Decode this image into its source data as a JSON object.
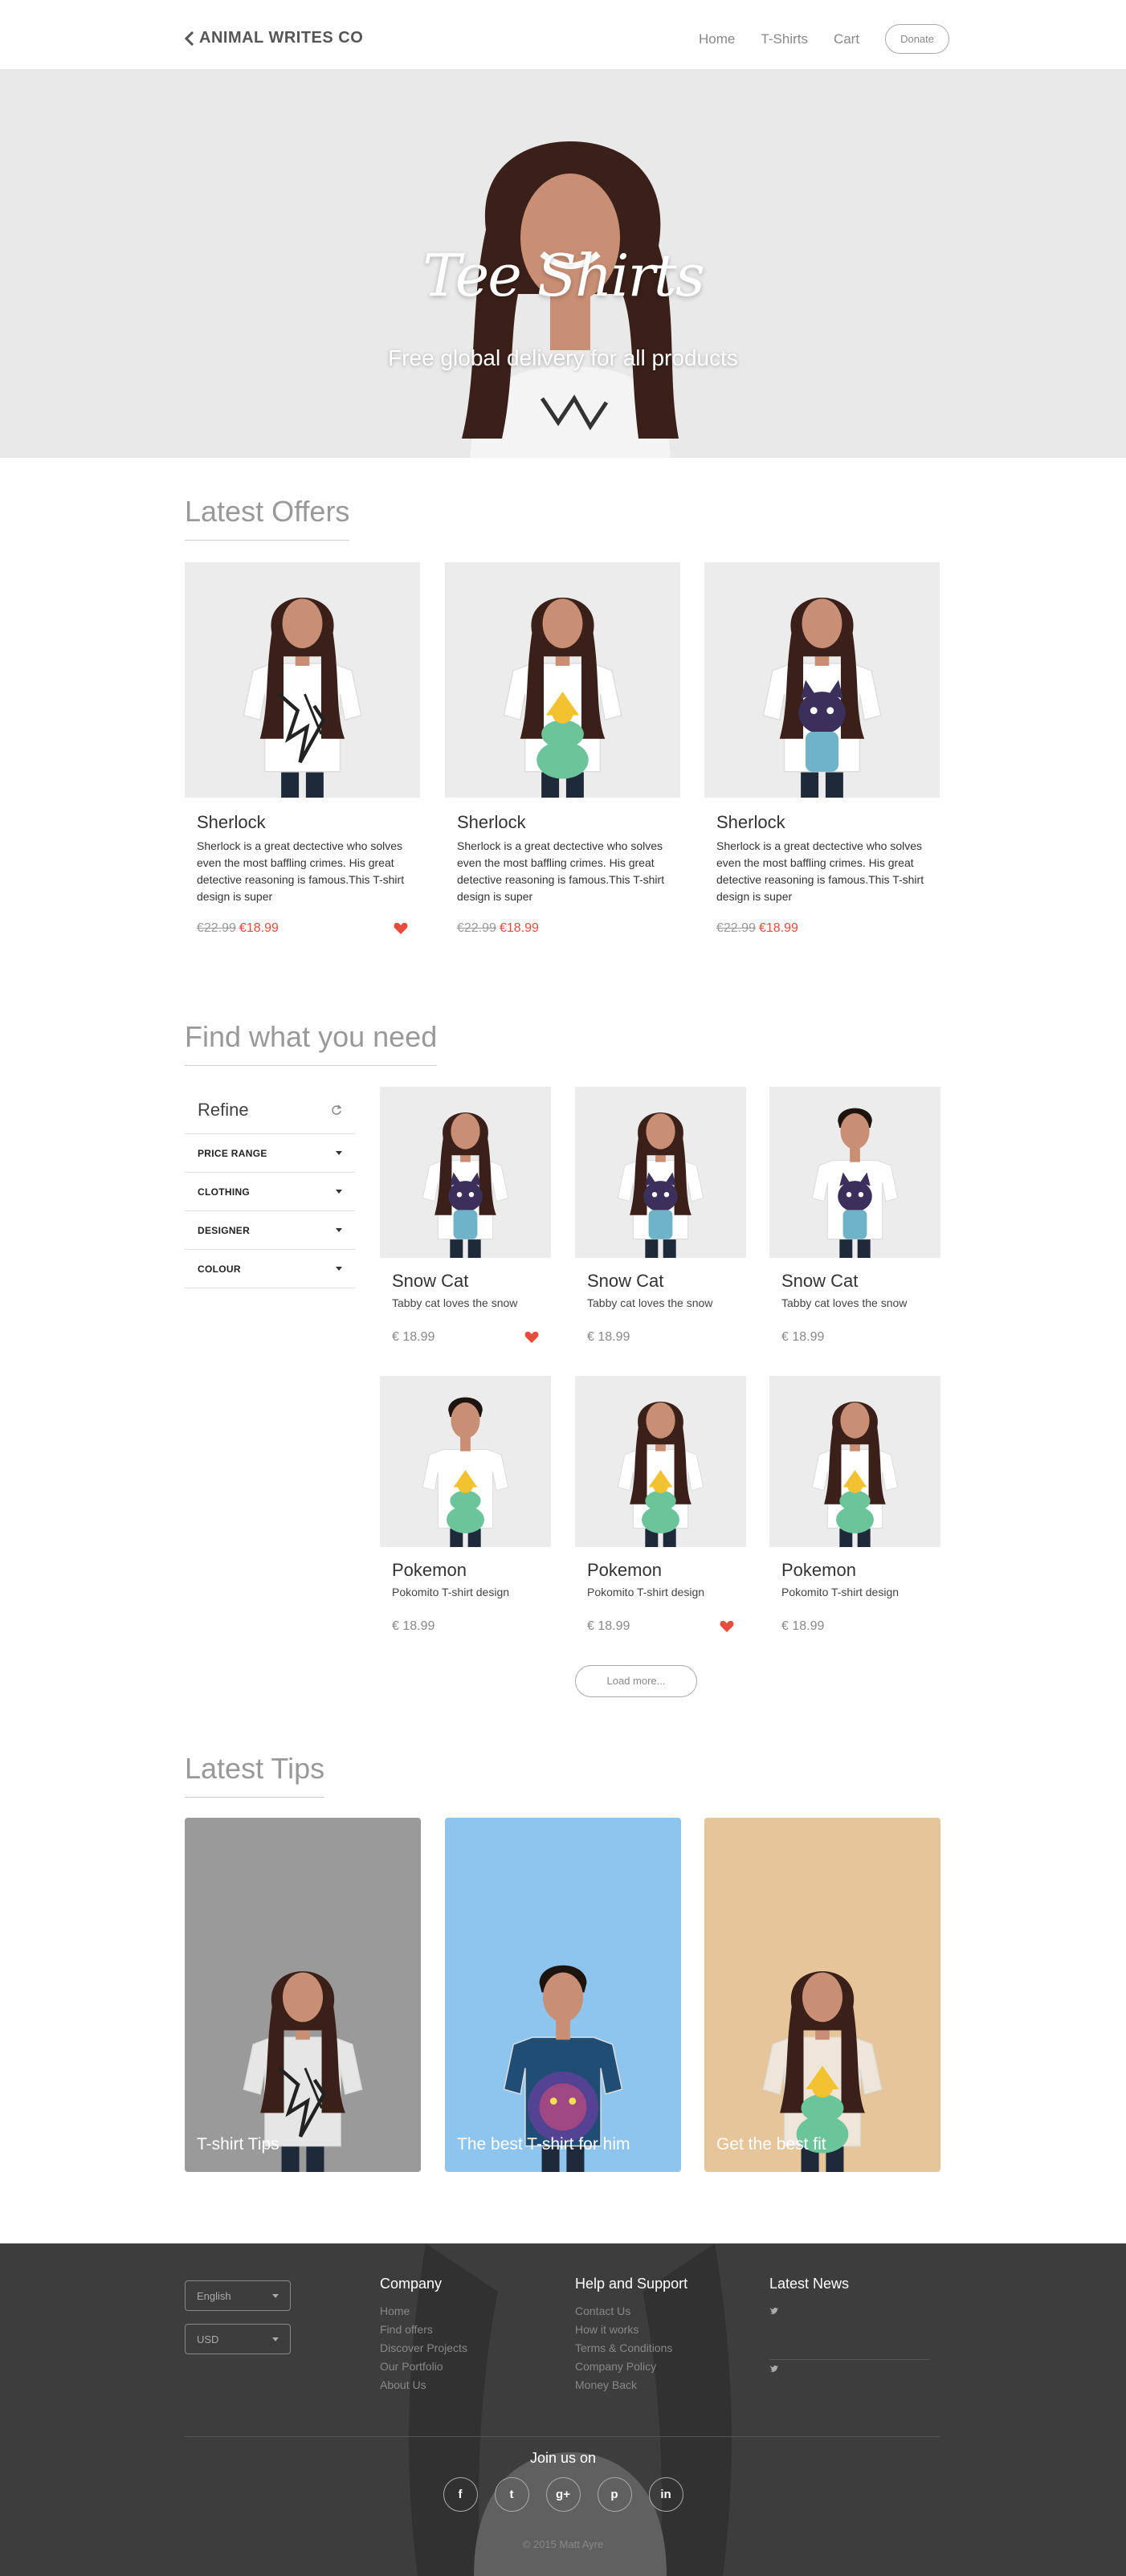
{
  "nav": {
    "brand": "ANIMAL WRITES CO",
    "links": [
      "Home",
      "T-Shirts",
      "Cart"
    ],
    "donate": "Donate"
  },
  "hero": {
    "title": "Tee Shirts",
    "subtitle": "Free global delivery for all products"
  },
  "offers": {
    "title": "Latest Offers",
    "items": [
      {
        "name": "Sherlock",
        "desc": "Sherlock is a great dectective who solves even the most baffling crimes. His great detective reasoning is famous.This T-shirt design is super",
        "old_price": "€22.99",
        "price": "€18.99",
        "liked": true,
        "print": "sketch",
        "shirt": "#ffffff"
      },
      {
        "name": "Sherlock",
        "desc": "Sherlock is a great dectective who solves even the most baffling crimes. His great detective reasoning is famous.This T-shirt design is super",
        "old_price": "€22.99",
        "price": "€18.99",
        "liked": false,
        "print": "pokemon",
        "shirt": "#ffffff"
      },
      {
        "name": "Sherlock",
        "desc": "Sherlock is a great dectective who solves even the most baffling crimes. His great detective reasoning is famous.This T-shirt design is super",
        "old_price": "€22.99",
        "price": "€18.99",
        "liked": false,
        "print": "cat",
        "shirt": "#ffffff"
      }
    ]
  },
  "find": {
    "title": "Find what you need",
    "refine": {
      "heading": "Refine",
      "filters": [
        "PRICE RANGE",
        "CLOTHING",
        "DESIGNER",
        "COLOUR"
      ]
    },
    "products": [
      {
        "name": "Snow Cat",
        "desc": "Tabby cat loves the snow",
        "price": "€ 18.99",
        "liked": true,
        "print": "cat",
        "person": "woman"
      },
      {
        "name": "Snow Cat",
        "desc": "Tabby cat loves the snow",
        "price": "€ 18.99",
        "liked": false,
        "print": "cat",
        "person": "woman"
      },
      {
        "name": "Snow Cat",
        "desc": "Tabby cat loves the snow",
        "price": "€ 18.99",
        "liked": false,
        "print": "cat",
        "person": "man"
      },
      {
        "name": "Pokemon",
        "desc": "Pokomito T-shirt design",
        "price": "€ 18.99",
        "liked": false,
        "print": "pokemon",
        "person": "man"
      },
      {
        "name": "Pokemon",
        "desc": "Pokomito T-shirt design",
        "price": "€ 18.99",
        "liked": true,
        "print": "pokemon",
        "person": "woman"
      },
      {
        "name": "Pokemon",
        "desc": "Pokomito T-shirt design",
        "price": "€ 18.99",
        "liked": false,
        "print": "pokemon",
        "person": "woman"
      }
    ],
    "load_more": "Load more..."
  },
  "tips": {
    "title": "Latest Tips",
    "items": [
      {
        "label": "T-shirt Tips",
        "bg": "#9a9a9a",
        "shirt": "#e6e6e6",
        "print": "sketch"
      },
      {
        "label": "The best T-shirt for him",
        "bg": "#8ec5ef",
        "shirt": "#1f4d74",
        "print": "lion"
      },
      {
        "label": "Get the best fit",
        "bg": "#e6c59a",
        "shirt": "#efe6d9",
        "print": "pokemon"
      }
    ]
  },
  "footer": {
    "language": "English",
    "currency": "USD",
    "company": {
      "title": "Company",
      "links": [
        "Home",
        "Find offers",
        "Discover Projects",
        "Our Portfolio",
        "About Us"
      ]
    },
    "support": {
      "title": "Help and Support",
      "links": [
        "Contact Us",
        "How it works",
        "Terms & Conditions",
        "Company Policy",
        "Money Back"
      ]
    },
    "news": {
      "title": "Latest News"
    },
    "join": "Join us on",
    "socials": [
      "f",
      "t",
      "g+",
      "p",
      "in"
    ],
    "copyright": "© 2015 Matt Ayre"
  },
  "colors": {
    "accent": "#e74c3c",
    "footer": "#3d3d3d",
    "hero": "#e9e9e9"
  }
}
